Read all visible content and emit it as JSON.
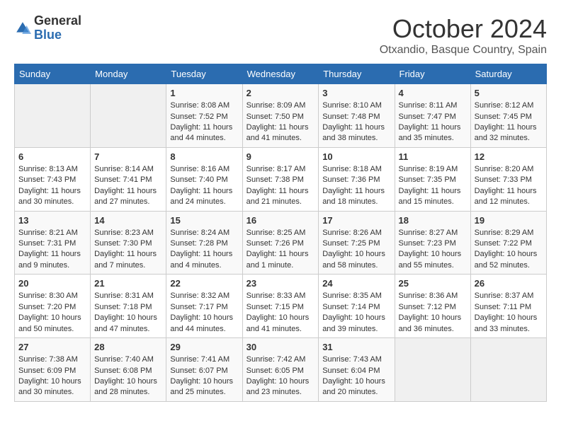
{
  "logo": {
    "general": "General",
    "blue": "Blue"
  },
  "header": {
    "month": "October 2024",
    "location": "Otxandio, Basque Country, Spain"
  },
  "days_of_week": [
    "Sunday",
    "Monday",
    "Tuesday",
    "Wednesday",
    "Thursday",
    "Friday",
    "Saturday"
  ],
  "weeks": [
    [
      {
        "day": "",
        "content": ""
      },
      {
        "day": "",
        "content": ""
      },
      {
        "day": "1",
        "content": "Sunrise: 8:08 AM\nSunset: 7:52 PM\nDaylight: 11 hours and 44 minutes."
      },
      {
        "day": "2",
        "content": "Sunrise: 8:09 AM\nSunset: 7:50 PM\nDaylight: 11 hours and 41 minutes."
      },
      {
        "day": "3",
        "content": "Sunrise: 8:10 AM\nSunset: 7:48 PM\nDaylight: 11 hours and 38 minutes."
      },
      {
        "day": "4",
        "content": "Sunrise: 8:11 AM\nSunset: 7:47 PM\nDaylight: 11 hours and 35 minutes."
      },
      {
        "day": "5",
        "content": "Sunrise: 8:12 AM\nSunset: 7:45 PM\nDaylight: 11 hours and 32 minutes."
      }
    ],
    [
      {
        "day": "6",
        "content": "Sunrise: 8:13 AM\nSunset: 7:43 PM\nDaylight: 11 hours and 30 minutes."
      },
      {
        "day": "7",
        "content": "Sunrise: 8:14 AM\nSunset: 7:41 PM\nDaylight: 11 hours and 27 minutes."
      },
      {
        "day": "8",
        "content": "Sunrise: 8:16 AM\nSunset: 7:40 PM\nDaylight: 11 hours and 24 minutes."
      },
      {
        "day": "9",
        "content": "Sunrise: 8:17 AM\nSunset: 7:38 PM\nDaylight: 11 hours and 21 minutes."
      },
      {
        "day": "10",
        "content": "Sunrise: 8:18 AM\nSunset: 7:36 PM\nDaylight: 11 hours and 18 minutes."
      },
      {
        "day": "11",
        "content": "Sunrise: 8:19 AM\nSunset: 7:35 PM\nDaylight: 11 hours and 15 minutes."
      },
      {
        "day": "12",
        "content": "Sunrise: 8:20 AM\nSunset: 7:33 PM\nDaylight: 11 hours and 12 minutes."
      }
    ],
    [
      {
        "day": "13",
        "content": "Sunrise: 8:21 AM\nSunset: 7:31 PM\nDaylight: 11 hours and 9 minutes."
      },
      {
        "day": "14",
        "content": "Sunrise: 8:23 AM\nSunset: 7:30 PM\nDaylight: 11 hours and 7 minutes."
      },
      {
        "day": "15",
        "content": "Sunrise: 8:24 AM\nSunset: 7:28 PM\nDaylight: 11 hours and 4 minutes."
      },
      {
        "day": "16",
        "content": "Sunrise: 8:25 AM\nSunset: 7:26 PM\nDaylight: 11 hours and 1 minute."
      },
      {
        "day": "17",
        "content": "Sunrise: 8:26 AM\nSunset: 7:25 PM\nDaylight: 10 hours and 58 minutes."
      },
      {
        "day": "18",
        "content": "Sunrise: 8:27 AM\nSunset: 7:23 PM\nDaylight: 10 hours and 55 minutes."
      },
      {
        "day": "19",
        "content": "Sunrise: 8:29 AM\nSunset: 7:22 PM\nDaylight: 10 hours and 52 minutes."
      }
    ],
    [
      {
        "day": "20",
        "content": "Sunrise: 8:30 AM\nSunset: 7:20 PM\nDaylight: 10 hours and 50 minutes."
      },
      {
        "day": "21",
        "content": "Sunrise: 8:31 AM\nSunset: 7:18 PM\nDaylight: 10 hours and 47 minutes."
      },
      {
        "day": "22",
        "content": "Sunrise: 8:32 AM\nSunset: 7:17 PM\nDaylight: 10 hours and 44 minutes."
      },
      {
        "day": "23",
        "content": "Sunrise: 8:33 AM\nSunset: 7:15 PM\nDaylight: 10 hours and 41 minutes."
      },
      {
        "day": "24",
        "content": "Sunrise: 8:35 AM\nSunset: 7:14 PM\nDaylight: 10 hours and 39 minutes."
      },
      {
        "day": "25",
        "content": "Sunrise: 8:36 AM\nSunset: 7:12 PM\nDaylight: 10 hours and 36 minutes."
      },
      {
        "day": "26",
        "content": "Sunrise: 8:37 AM\nSunset: 7:11 PM\nDaylight: 10 hours and 33 minutes."
      }
    ],
    [
      {
        "day": "27",
        "content": "Sunrise: 7:38 AM\nSunset: 6:09 PM\nDaylight: 10 hours and 30 minutes."
      },
      {
        "day": "28",
        "content": "Sunrise: 7:40 AM\nSunset: 6:08 PM\nDaylight: 10 hours and 28 minutes."
      },
      {
        "day": "29",
        "content": "Sunrise: 7:41 AM\nSunset: 6:07 PM\nDaylight: 10 hours and 25 minutes."
      },
      {
        "day": "30",
        "content": "Sunrise: 7:42 AM\nSunset: 6:05 PM\nDaylight: 10 hours and 23 minutes."
      },
      {
        "day": "31",
        "content": "Sunrise: 7:43 AM\nSunset: 6:04 PM\nDaylight: 10 hours and 20 minutes."
      },
      {
        "day": "",
        "content": ""
      },
      {
        "day": "",
        "content": ""
      }
    ]
  ]
}
